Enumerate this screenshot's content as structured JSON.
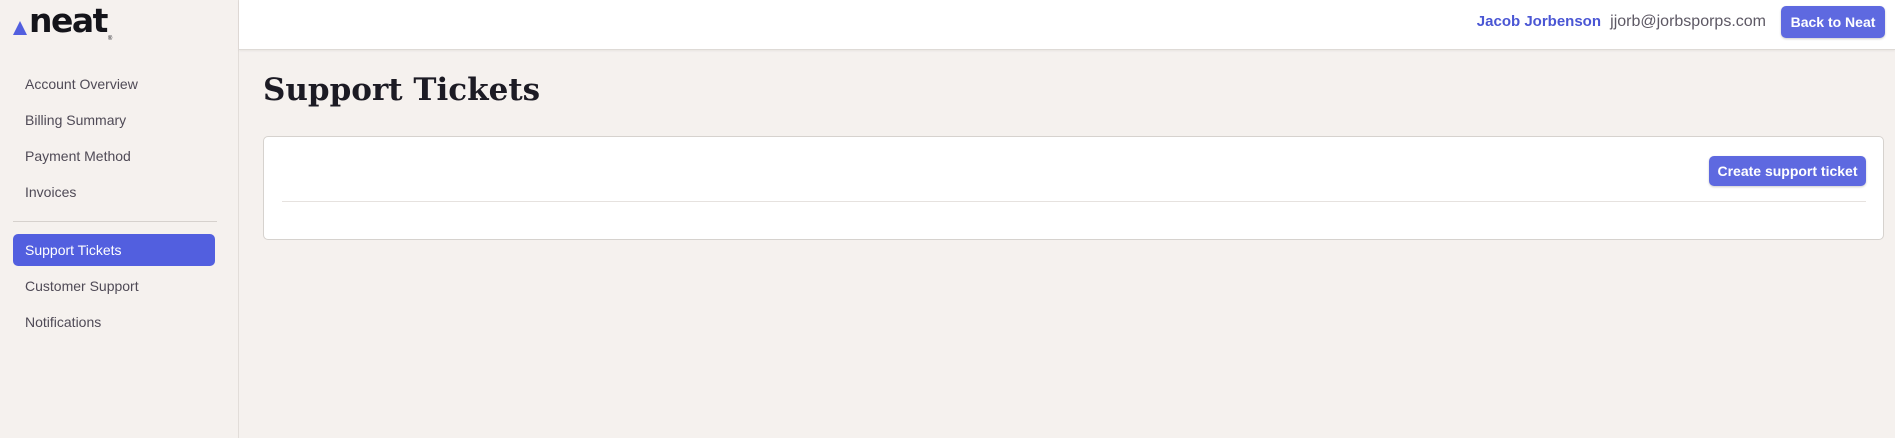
{
  "brand": {
    "logo_text": "neat",
    "logo_reg": "®"
  },
  "sidebar": {
    "items": [
      {
        "label": "Account Overview"
      },
      {
        "label": "Billing Summary"
      },
      {
        "label": "Payment Method"
      },
      {
        "label": "Invoices"
      },
      {
        "label": "Support Tickets",
        "active": true
      },
      {
        "label": "Customer Support"
      },
      {
        "label": "Notifications"
      }
    ]
  },
  "header": {
    "user_name": "Jacob Jorbenson",
    "user_email": "jjorb@jorbsporps.com",
    "back_label": "Back to Neat"
  },
  "main": {
    "title": "Support Tickets",
    "create_label": "Create support ticket"
  },
  "colors": {
    "accent": "#525fdf",
    "button": "#5e69e0",
    "user_name": "#4a56d4",
    "background": "#f5f1ee"
  }
}
